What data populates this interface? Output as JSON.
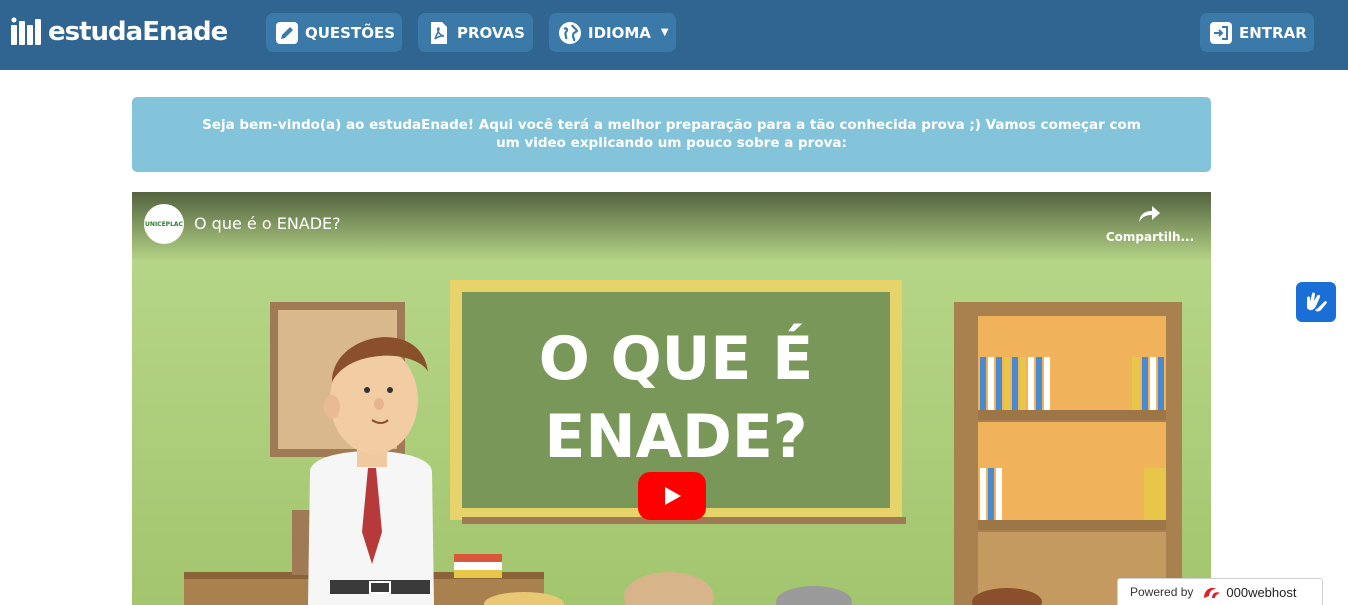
{
  "navbar": {
    "brand": "estudaEnade",
    "questoes_label": "QUESTÕES",
    "provas_label": "PROVAS",
    "idioma_label": "IDIOMA",
    "entrar_label": "ENTRAR",
    "bg_color": "#2f6590",
    "button_color": "#3a79a8"
  },
  "alert": {
    "text": "Seja bem-vindo(a) ao estudaEnade! Aqui você terá a melhor preparação para a tão conhecida prova ;) Vamos começar com um video explicando um pouco sobre a prova:",
    "bg_color": "#84c4da"
  },
  "video": {
    "channel": "UNICEPLAC",
    "title": "O que é o ENADE?",
    "share_label": "Compartilh...",
    "board_line1": "O QUE É",
    "board_line2": "ENADE?",
    "play_color": "#ff0000"
  },
  "vlibras": {
    "icon": "hands-sign-language-icon",
    "color": "#1a6fd6"
  },
  "powered": {
    "label": "Powered by",
    "host": "000webhost"
  }
}
